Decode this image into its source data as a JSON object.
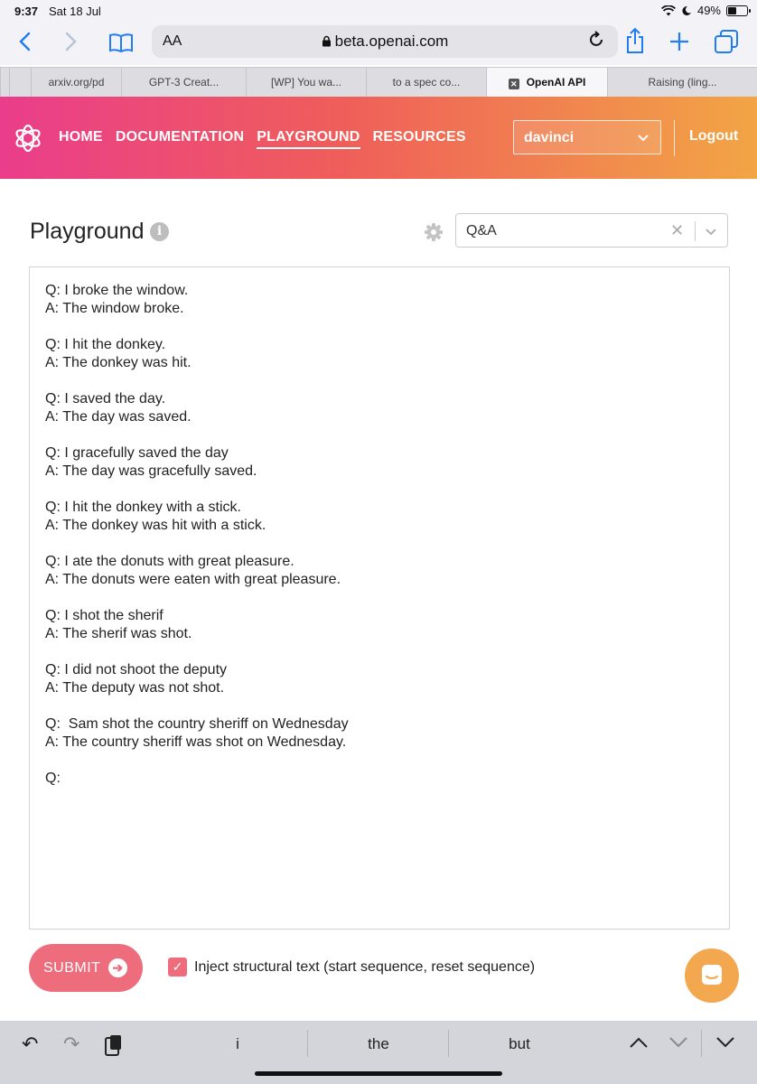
{
  "status": {
    "time": "9:37",
    "date": "Sat 18 Jul",
    "battery": "49%",
    "battery_level": 0.49
  },
  "browser": {
    "text_size_label": "AA",
    "url": "beta.openai.com",
    "tabs": [
      {
        "label": ""
      },
      {
        "label": "arxiv.org/pd"
      },
      {
        "label": "GPT-3 Creat..."
      },
      {
        "label": "[WP] You wa..."
      },
      {
        "label": "to a spec co..."
      },
      {
        "label": "OpenAI API",
        "active": true
      },
      {
        "label": "Raising (ling..."
      }
    ]
  },
  "header": {
    "nav": [
      "HOME",
      "DOCUMENTATION",
      "PLAYGROUND",
      "RESOURCES"
    ],
    "active_nav": "PLAYGROUND",
    "engine": "davinci",
    "logout": "Logout"
  },
  "playground": {
    "title": "Playground",
    "info_icon": "i",
    "preset": "Q&A",
    "prompt_lines": [
      "Q: I broke the window.",
      "A: The window broke.",
      "",
      "Q: I hit the donkey.",
      "A: The donkey was hit.",
      "",
      "Q: I saved the day.",
      "A: The day was saved.",
      "",
      "Q: I gracefully saved the day",
      "A: The day was gracefully saved.",
      "",
      "Q: I hit the donkey with a stick.",
      "A: The donkey was hit with a stick.",
      "",
      "Q: I ate the donuts with great pleasure.",
      "A: The donuts were eaten with great pleasure.",
      "",
      "Q: I shot the sherif",
      "A: The sherif was shot.",
      "",
      "Q: I did not shoot the deputy",
      "A: The deputy was not shot.",
      "",
      "Q:  Sam shot the country sheriff on Wednesday",
      "A: The country sheriff was shot on Wednesday.",
      "",
      "Q:"
    ],
    "submit": "SUBMIT",
    "inject_label": "Inject structural text (start sequence, reset sequence)",
    "inject_checked": true
  },
  "keyboard": {
    "suggestions": [
      "i",
      "the",
      "but"
    ]
  },
  "colors": {
    "accent": "#ee6d7d",
    "link": "#1f7cf2",
    "chat": "#f3a84f"
  }
}
